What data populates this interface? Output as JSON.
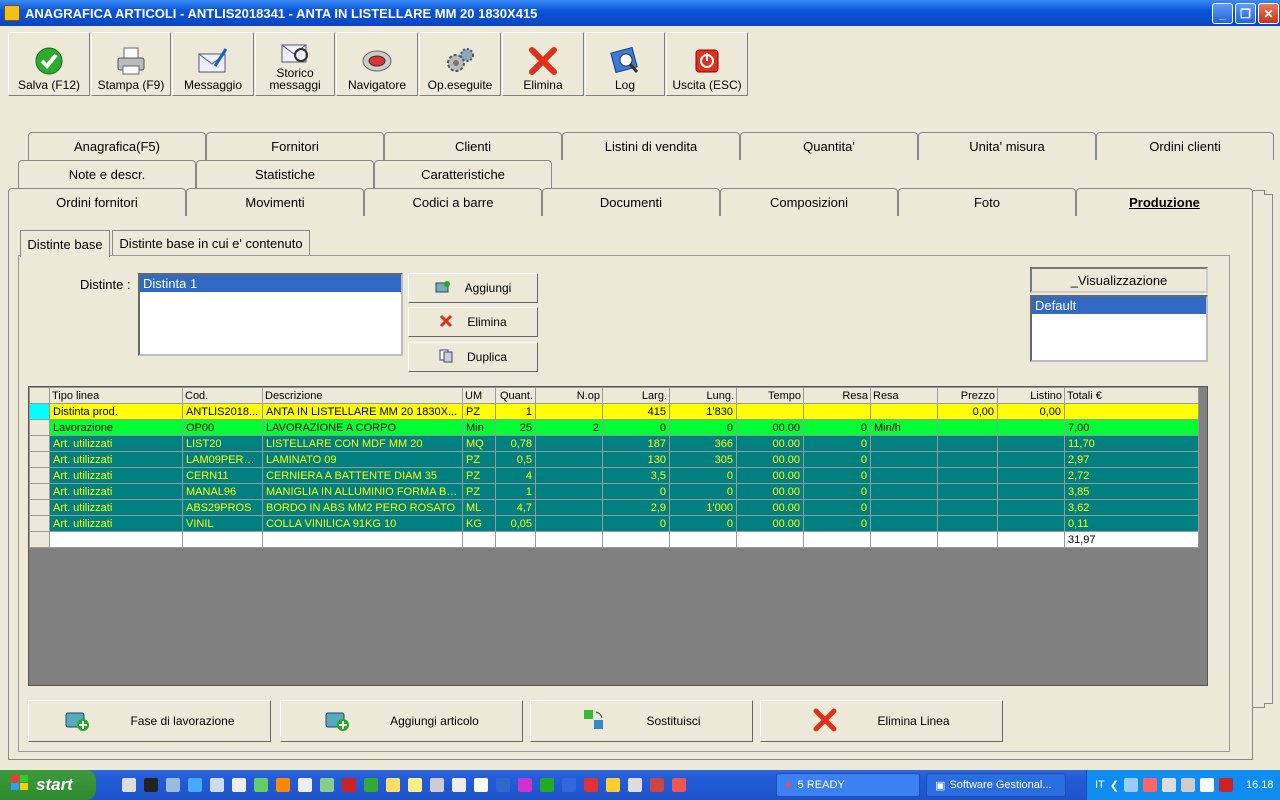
{
  "window": {
    "title": "ANAGRAFICA ARTICOLI - ANTLIS2018341 - ANTA IN LISTELLARE MM 20 1830X415"
  },
  "toolbar": [
    {
      "label": "Salva (F12)",
      "icon": "check-icon"
    },
    {
      "label": "Stampa (F9)",
      "icon": "printer-icon"
    },
    {
      "label": "Messaggio",
      "icon": "envelope-icon"
    },
    {
      "label": "Storico messaggi",
      "icon": "message-history-icon"
    },
    {
      "label": "Navigatore",
      "icon": "compass-icon"
    },
    {
      "label": "Op.eseguite",
      "icon": "gears-icon"
    },
    {
      "label": "Elimina",
      "icon": "x-icon"
    },
    {
      "label": "Log",
      "icon": "log-icon"
    },
    {
      "label": "Uscita (ESC)",
      "icon": "exit-icon"
    }
  ],
  "tabs": {
    "row1": [
      "Anagrafica(F5)",
      "Fornitori",
      "Clienti",
      "Listini di vendita",
      "Quantita'",
      "Unita' misura",
      "Ordini clienti"
    ],
    "row2": [
      "Note e descr.",
      "Statistiche",
      "Caratteristiche"
    ],
    "row3": [
      "Ordini fornitori",
      "Movimenti",
      "Codici a barre",
      "Documenti",
      "Composizioni",
      "Foto",
      "Produzione"
    ]
  },
  "subtabs": [
    "Distinte base",
    "Distinte base in cui e' contenuto"
  ],
  "distinte": {
    "label": "Distinte :",
    "items": [
      "Distinta 1"
    ]
  },
  "distinte_buttons": {
    "add": "Aggiungi",
    "delete": "Elimina",
    "duplicate": "Duplica"
  },
  "visualizzazione": {
    "title": "_Visualizzazione",
    "items": [
      "Default"
    ]
  },
  "grid": {
    "columns": [
      "Tipo linea",
      "Cod.",
      "Descrizione",
      "UM",
      "Quant.",
      "N.op",
      "Larg.",
      "Lung.",
      "Tempo",
      "Resa",
      "Resa",
      "Prezzo",
      "Listino",
      "Totali €"
    ],
    "rows": [
      {
        "style": "yellow",
        "cells": [
          "Distinta prod.",
          "ANTLIS2018...",
          "ANTA IN LISTELLARE MM 20 1830X...",
          "PZ",
          "1",
          "",
          "415",
          "1'830",
          "",
          "",
          "",
          "0,00",
          "0,00",
          ""
        ]
      },
      {
        "style": "green",
        "cells": [
          "Lavorazione",
          "OP00",
          "LAVORAZIONE A CORPO",
          "Min",
          "25",
          "2",
          "0",
          "0",
          "00.00",
          "0",
          "Min/h",
          "",
          "",
          "7,00"
        ]
      },
      {
        "style": "teal",
        "cells": [
          "Art. utilizzati",
          "LIST20",
          "LISTELLARE  CON MDF MM 20",
          "MQ",
          "0,78",
          "",
          "187",
          "366",
          "00.00",
          "0",
          "",
          "",
          "",
          "11,70"
        ]
      },
      {
        "style": "teal",
        "cells": [
          "Art. utilizzati",
          "LAM09PERR...",
          "LAMINATO 09",
          "PZ",
          "0,5",
          "",
          "130",
          "305",
          "00.00",
          "0",
          "",
          "",
          "",
          "2,97"
        ]
      },
      {
        "style": "teal",
        "cells": [
          "Art. utilizzati",
          "CERN11",
          "CERNIERA A BATTENTE DIAM 35",
          "PZ",
          "4",
          "",
          "3,5",
          "0",
          "00.00",
          "0",
          "",
          "",
          "",
          "2,72"
        ]
      },
      {
        "style": "teal",
        "cells": [
          "Art. utilizzati",
          "MANAL96",
          "MANIGLIA IN ALLUMINIO FORMA B I...",
          "PZ",
          "1",
          "",
          "0",
          "0",
          "00.00",
          "0",
          "",
          "",
          "",
          "3,85"
        ]
      },
      {
        "style": "teal",
        "cells": [
          "Art. utilizzati",
          "ABS29PROS",
          "BORDO IN ABS MM2 PERO ROSATO",
          "ML",
          "4,7",
          "",
          "2,9",
          "1'000",
          "00.00",
          "0",
          "",
          "",
          "",
          "3,62"
        ]
      },
      {
        "style": "teal",
        "cells": [
          "Art. utilizzati",
          "VINIL",
          "COLLA VINILICA 91KG 10",
          "KG",
          "0,05",
          "",
          "0",
          "0",
          "00.00",
          "0",
          "",
          "",
          "",
          "0,11"
        ]
      },
      {
        "style": "white",
        "cells": [
          "",
          "",
          "",
          "",
          "",
          "",
          "",
          "",
          "",
          "",
          "",
          "",
          "",
          "31,97"
        ]
      }
    ]
  },
  "bottom_buttons": [
    {
      "label": "Fase di lavorazione",
      "icon": "add-phase-icon"
    },
    {
      "label": "Aggiungi articolo",
      "icon": "add-item-icon"
    },
    {
      "label": "Sostituisci",
      "icon": "replace-icon"
    },
    {
      "label": "Elimina Linea",
      "icon": "delete-line-icon"
    }
  ],
  "taskbar": {
    "start": "start",
    "tasks": [
      "5 READY",
      "Software Gestional..."
    ],
    "lang": "IT",
    "clock": "16.18"
  }
}
